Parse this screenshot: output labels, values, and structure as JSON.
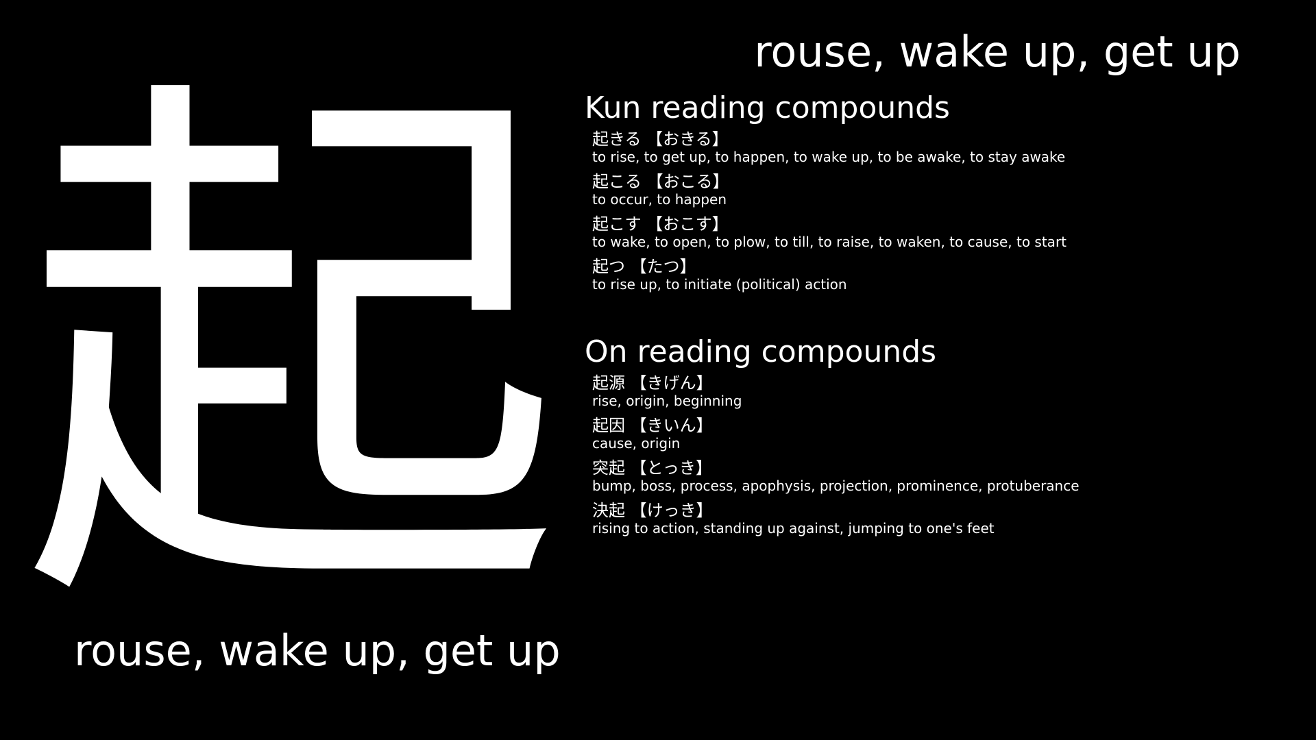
{
  "kanji": "起",
  "meaning": "rouse, wake up, get up",
  "kun": {
    "title": "Kun reading compounds",
    "entries": [
      {
        "word": "起きる 【おきる】",
        "gloss": "to rise, to get up, to happen, to wake up, to be awake, to stay awake"
      },
      {
        "word": "起こる 【おこる】",
        "gloss": "to occur, to happen"
      },
      {
        "word": "起こす 【おこす】",
        "gloss": "to wake, to open, to plow, to till, to raise, to waken, to cause, to start"
      },
      {
        "word": "起つ 【たつ】",
        "gloss": "to rise up, to initiate (political) action"
      }
    ]
  },
  "on": {
    "title": "On reading compounds",
    "entries": [
      {
        "word": "起源 【きげん】",
        "gloss": "rise, origin, beginning"
      },
      {
        "word": "起因 【きいん】",
        "gloss": "cause, origin"
      },
      {
        "word": "突起 【とっき】",
        "gloss": "bump, boss, process, apophysis, projection, prominence, protuberance"
      },
      {
        "word": "決起 【けっき】",
        "gloss": "rising to action, standing up against, jumping to one's feet"
      }
    ]
  }
}
